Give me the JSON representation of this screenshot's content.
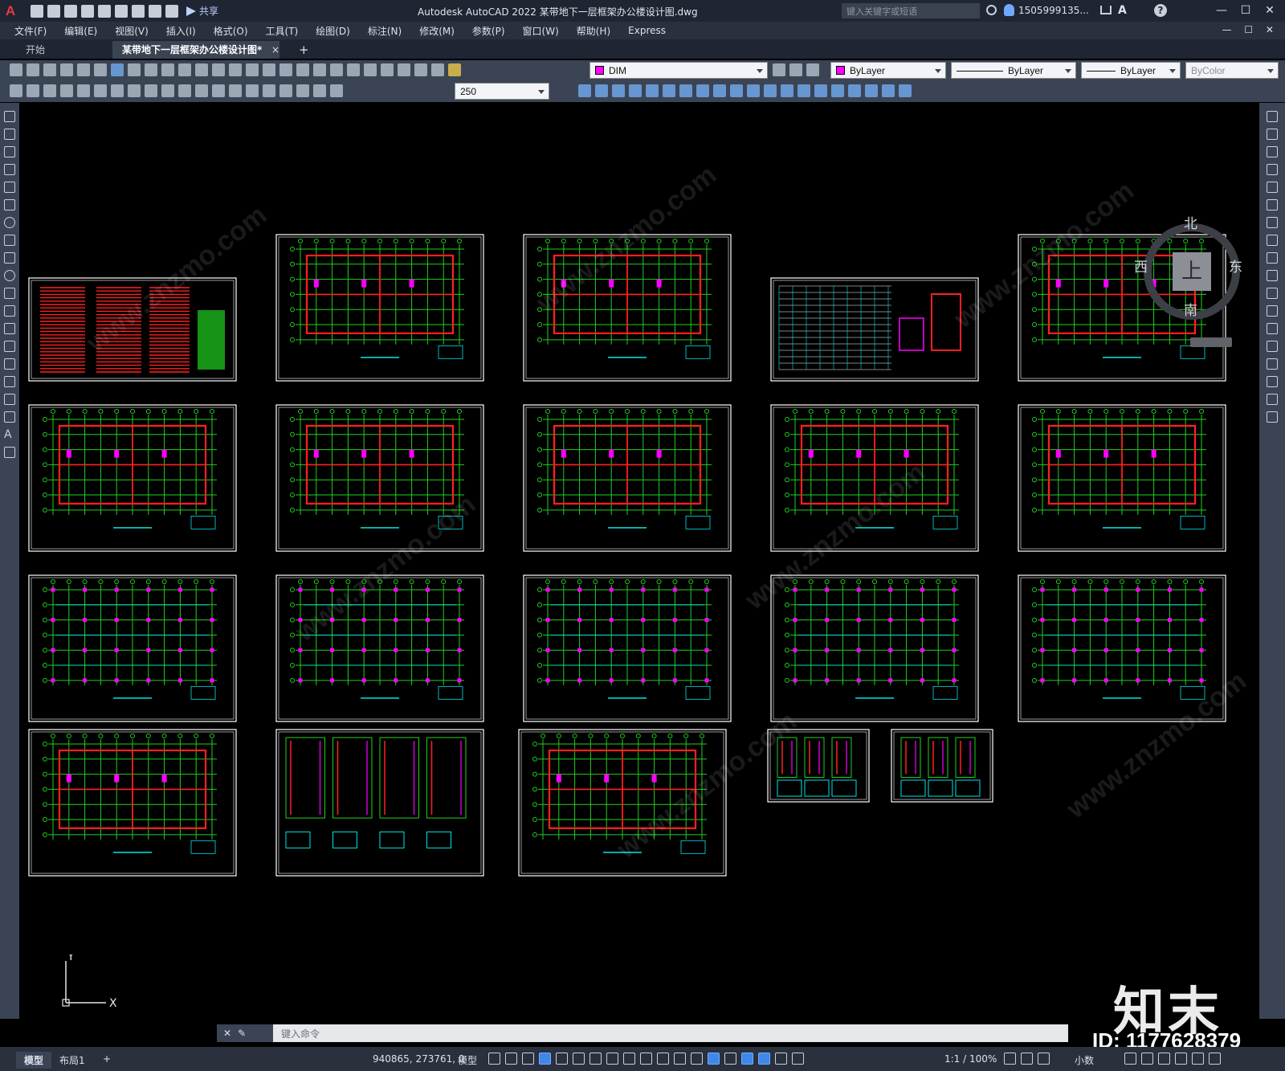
{
  "titlebar": {
    "logo": "A",
    "share_label": "共享",
    "app_title": "Autodesk AutoCAD 2022    某带地下一层框架办公楼设计图.dwg",
    "search_placeholder": "键入关键字或短语",
    "user_name": "1505999135...",
    "help": "?",
    "min": "—",
    "max": "☐",
    "close": "✕"
  },
  "menubar": {
    "items": [
      "文件(F)",
      "编辑(E)",
      "视图(V)",
      "插入(I)",
      "格式(O)",
      "工具(T)",
      "绘图(D)",
      "标注(N)",
      "修改(M)",
      "参数(P)",
      "窗口(W)",
      "帮助(H)",
      "Express"
    ],
    "doc_controls": "— ☐ ✕"
  },
  "tabs": {
    "start": "开始",
    "drawing": "某带地下一层框架办公楼设计图*",
    "close": "×",
    "add": "+"
  },
  "toolbar1": {
    "layer_name": "DIM",
    "layer_color": "#ff00ff",
    "color": "ByLayer",
    "linetype": "ByLayer",
    "lineweight": "ByLayer",
    "plotstyle": "ByColor"
  },
  "toolbar2": {
    "dim_scale": "250"
  },
  "viewcube": {
    "top": "上",
    "north": "北",
    "south": "南",
    "east": "东",
    "west": "西"
  },
  "ucs": {
    "x": "X",
    "y": "Y"
  },
  "watermark": {
    "text": "www.znzmo.com",
    "brand": "知末",
    "id": "ID: 1177628379"
  },
  "cmdline": {
    "prompt": "键入命令"
  },
  "statusbar": {
    "model_tab": "模型",
    "layout_tab": "布局1",
    "add": "+",
    "coords": "940865, 273761, 0",
    "model_label": "模型",
    "scale": "1:1 / 100%",
    "units": "小数"
  },
  "colors": {
    "green": "#1fd01f",
    "red": "#ff2020",
    "magenta": "#ff00ff",
    "cyan": "#00e5e5",
    "yellow": "#ffff00",
    "white": "#ffffff"
  }
}
